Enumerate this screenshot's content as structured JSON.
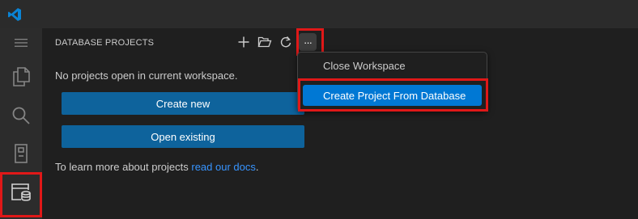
{
  "titlebar": {
    "logo_icon": "vscode-logo"
  },
  "activity_bar": {
    "items": [
      {
        "name": "menu",
        "icon": "hamburger-icon"
      },
      {
        "name": "explorer",
        "icon": "files-icon"
      },
      {
        "name": "search",
        "icon": "search-icon"
      },
      {
        "name": "notebooks",
        "icon": "notebook-icon"
      },
      {
        "name": "database-projects",
        "icon": "database-project-icon",
        "active": true
      }
    ]
  },
  "panel": {
    "title": "DATABASE PROJECTS",
    "toolbar": {
      "new_icon": "plus-icon",
      "open_icon": "folder-open-icon",
      "refresh_icon": "refresh-icon",
      "more_label": "···"
    },
    "empty_message": "No projects open in current workspace.",
    "create_new_label": "Create new",
    "open_existing_label": "Open existing",
    "learn_prefix": "To learn more about projects ",
    "learn_link": "read our docs",
    "learn_suffix": "."
  },
  "context_menu": {
    "items": [
      {
        "label": "Close Workspace"
      },
      {
        "label": "Create Project From Database",
        "selected": true
      }
    ]
  },
  "colors": {
    "accent": "#0078d4",
    "button": "#0e639c",
    "link": "#3794ff",
    "highlight_outline": "#e01818"
  }
}
